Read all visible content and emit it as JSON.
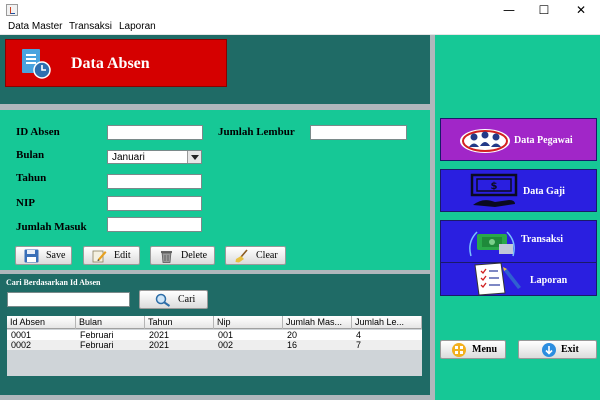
{
  "window": {
    "minimize": "—",
    "maximize": "☐",
    "close": "✕"
  },
  "menu": [
    "Data Master",
    "Transaksi",
    "Laporan"
  ],
  "header": {
    "title": "Data Absen"
  },
  "form": {
    "id_absen_label": "ID Absen",
    "jumlah_lembur_label": "Jumlah Lembur",
    "bulan_label": "Bulan",
    "bulan_value": "Januari",
    "tahun_label": "Tahun",
    "nip_label": "NIP",
    "jumlah_masuk_label": "Jumlah Masuk",
    "id_absen_value": "",
    "jumlah_lembur_value": "",
    "tahun_value": "",
    "nip_value": "",
    "jumlah_masuk_value": ""
  },
  "actions": {
    "save": "Save",
    "edit": "Edit",
    "delete": "Delete",
    "clear": "Clear"
  },
  "search": {
    "caption": "Cari Berdasarkan Id Absen",
    "value": "",
    "button": "Cari"
  },
  "table": {
    "headers": [
      "Id Absen",
      "Bulan",
      "Tahun",
      "Nip",
      "Jumlah Mas...",
      "Jumlah Le..."
    ],
    "rows": [
      [
        "0001",
        "Februari",
        "2021",
        "001",
        "20",
        "4"
      ],
      [
        "0002",
        "Februari",
        "2021",
        "002",
        "16",
        "7"
      ]
    ]
  },
  "sidebar": {
    "data_pegawai": "Data Pegawai",
    "data_gaji": "Data Gaji",
    "transaksi": "Transaksi",
    "laporan": "Laporan",
    "menu": "Menu",
    "exit": "Exit"
  },
  "colors": {
    "dark_panel": "#1f6b66",
    "green_panel": "#16c896",
    "header_red": "#d50000",
    "pegawai_purple": "#a126c8",
    "blue_button": "#2a1fe0"
  },
  "icons": {
    "header": "document-clock-icon",
    "save": "floppy-disk-icon",
    "edit": "pencil-paper-icon",
    "delete": "trash-bin-icon",
    "clear": "broom-icon",
    "search": "magnifier-icon",
    "pegawai": "people-group-icon",
    "gaji": "money-hand-icon",
    "transaksi": "money-card-icon",
    "laporan": "checklist-pencil-icon",
    "menu": "grid-menu-icon",
    "exit": "down-arrow-icon"
  }
}
